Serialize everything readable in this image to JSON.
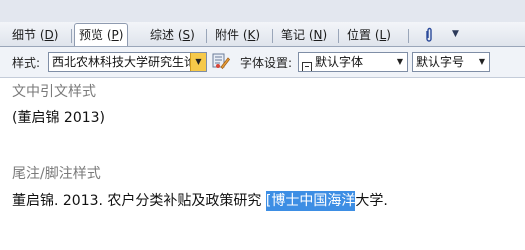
{
  "tabs": [
    {
      "label": "细节 (D)",
      "text": "细节 (",
      "key": "D",
      "tail": ")"
    },
    {
      "label": "预览 (P)",
      "text": "预览 (",
      "key": "P",
      "tail": ")"
    },
    {
      "label": "综述 (S)",
      "text": "综述 (",
      "key": "S",
      "tail": ")"
    },
    {
      "label": "附件 (K)",
      "text": "附件 (",
      "key": "K",
      "tail": ")"
    },
    {
      "label": "笔记 (N)",
      "text": "笔记 (",
      "key": "N",
      "tail": ")"
    },
    {
      "label": "位置 (L)",
      "text": "位置 (",
      "key": "L",
      "tail": ")"
    }
  ],
  "active_tab": "预览 (P)",
  "toolbar": {
    "style_label": "样式:",
    "style_value": "西北农林科技大学研究生论",
    "font_label": "字体设置:",
    "font_value": "默认字体",
    "size_value": "默认字号"
  },
  "preview": {
    "citation_heading": "文中引文样式",
    "citation_text": "(董启锦 2013)",
    "footnote_heading": "尾注/脚注样式",
    "footnote_before": "董启锦. 2013. 农户分类补贴及政策研究 ",
    "footnote_highlight": "[博士中国海洋",
    "footnote_after": "大学."
  },
  "colors": {
    "accent": "#3d8ee4",
    "combo_arrow": "#f6c94a",
    "muted_text": "#7a7a7a"
  },
  "icons": {
    "paperclip": "paperclip-icon",
    "edit_style": "edit-style-icon",
    "font": "font-icon"
  }
}
